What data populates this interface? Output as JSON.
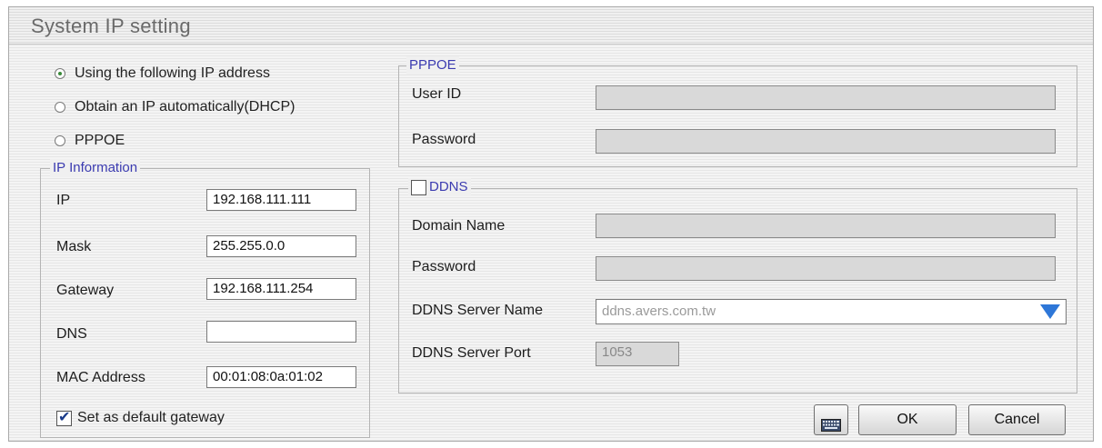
{
  "window": {
    "title": "System IP setting"
  },
  "ip_mode": {
    "options": [
      {
        "label": "Using the following IP address",
        "checked": true
      },
      {
        "label": "Obtain an IP automatically(DHCP)",
        "checked": false
      },
      {
        "label": "PPPOE",
        "checked": false
      }
    ]
  },
  "ip_info": {
    "legend": "IP Information",
    "ip_label": "IP",
    "ip_value": "192.168.111.111",
    "mask_label": "Mask",
    "mask_value": "255.255.0.0",
    "gateway_label": "Gateway",
    "gateway_value": "192.168.111.254",
    "dns_label": "DNS",
    "dns_value": "",
    "mac_label": "MAC Address",
    "mac_value": "00:01:08:0a:01:02",
    "default_gateway_label": "Set as default gateway",
    "default_gateway_checked": true
  },
  "pppoe": {
    "legend": "PPPOE",
    "user_id_label": "User ID",
    "user_id_value": "",
    "password_label": "Password",
    "password_value": ""
  },
  "ddns": {
    "legend": "DDNS",
    "enabled": false,
    "domain_label": "Domain Name",
    "domain_value": "",
    "password_label": "Password",
    "password_value": "",
    "server_name_label": "DDNS Server Name",
    "server_name_value": "ddns.avers.com.tw",
    "server_port_label": "DDNS Server Port",
    "server_port_value": "1053"
  },
  "buttons": {
    "keyboard_icon": "keyboard-icon",
    "ok_label": "OK",
    "cancel_label": "Cancel"
  },
  "colors": {
    "legend": "#3b3bb0",
    "dropdown_arrow": "#2e77d8",
    "check": "#1a3b8a"
  }
}
